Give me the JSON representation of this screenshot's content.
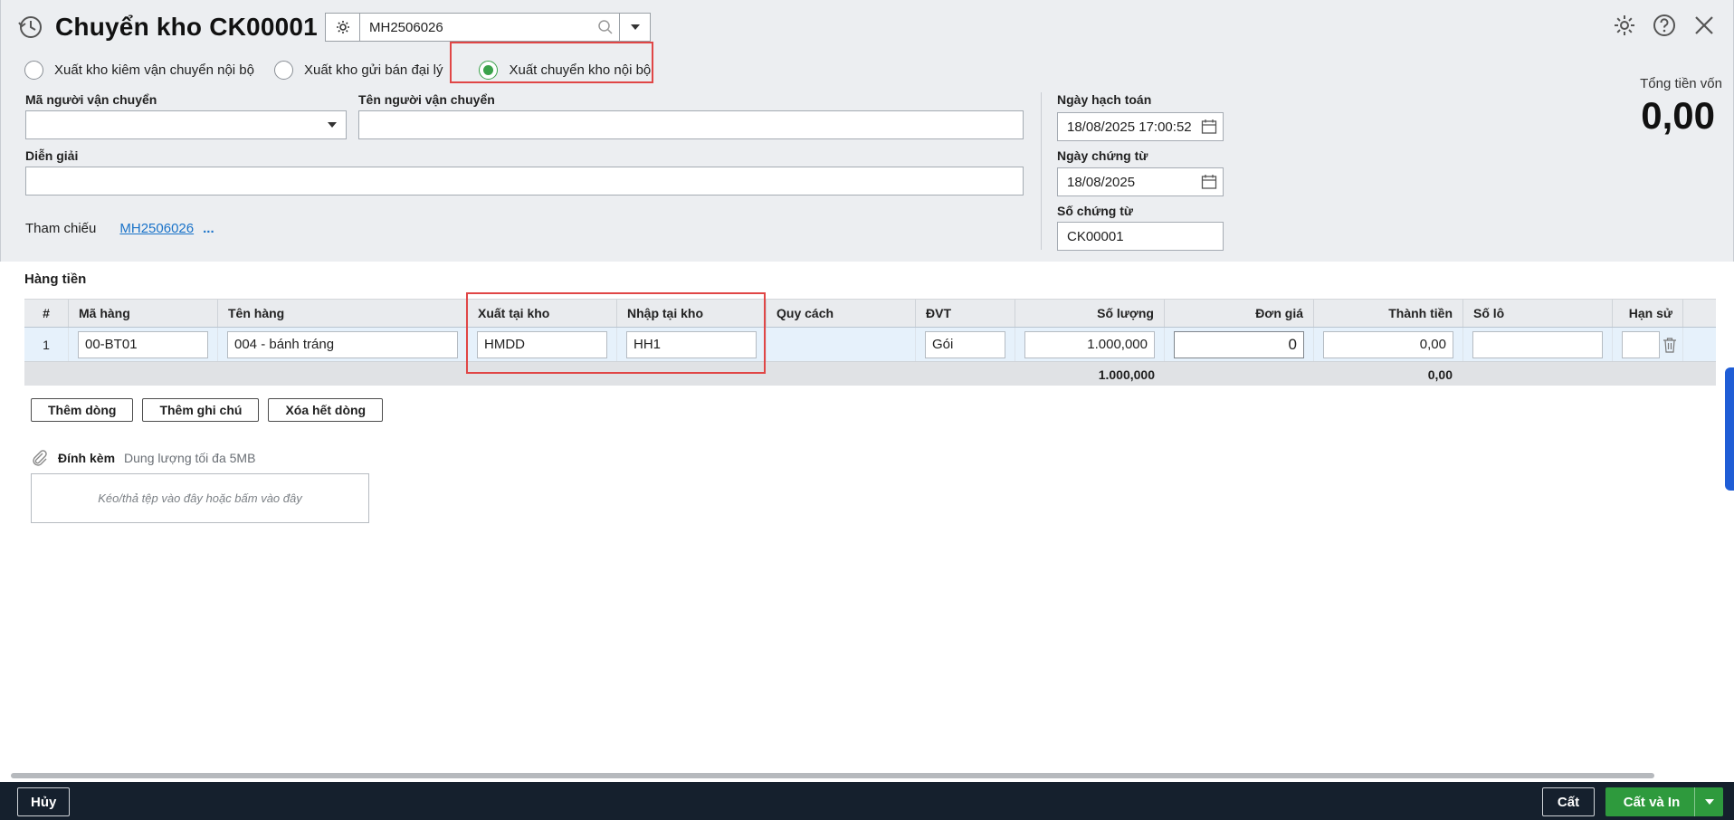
{
  "header": {
    "title": "Chuyển kho CK00001",
    "reference_value": "MH2506026"
  },
  "radios": [
    {
      "label": "Xuất kho kiêm vận chuyển nội bộ",
      "selected": false
    },
    {
      "label": "Xuất kho gửi bán đại lý",
      "selected": false
    },
    {
      "label": "Xuất chuyển kho nội bộ",
      "selected": true
    }
  ],
  "form": {
    "carrier_code_label": "Mã người vận chuyển",
    "carrier_code_value": "",
    "carrier_name_label": "Tên người vận chuyển",
    "carrier_name_value": "",
    "description_label": "Diễn giải",
    "description_value": "",
    "reference_label": "Tham chiếu",
    "reference_link": "MH2506026",
    "reference_more": "...",
    "posting_date_label": "Ngày hạch toán",
    "posting_date_value": "18/08/2025 17:00:52",
    "voucher_date_label": "Ngày chứng từ",
    "voucher_date_value": "18/08/2025",
    "voucher_no_label": "Số chứng từ",
    "voucher_no_value": "CK00001"
  },
  "total": {
    "label": "Tổng tiền vốn",
    "value": "0,00"
  },
  "grid": {
    "section_title": "Hàng tiền",
    "columns": [
      "#",
      "Mã hàng",
      "Tên hàng",
      "Xuất tại kho",
      "Nhập tại kho",
      "Quy cách",
      "ĐVT",
      "Số lượng",
      "Đơn giá",
      "Thành tiền",
      "Số lô",
      "Hạn sử"
    ],
    "rows": [
      {
        "no": "1",
        "code": "00-BT01",
        "name": "004 - bánh tráng",
        "from_wh": "HMDD",
        "to_wh": "HH1",
        "spec": "",
        "unit": "Gói",
        "qty": "1.000,000",
        "price": "0",
        "amount": "0,00",
        "lot": "",
        "expiry": ""
      }
    ],
    "sum_qty": "1.000,000",
    "sum_amount": "0,00"
  },
  "actions": {
    "add_row": "Thêm dòng",
    "add_note": "Thêm ghi chú",
    "delete_all": "Xóa hết dòng"
  },
  "attachment": {
    "title": "Đính kèm",
    "limit": "Dung lượng tối đa 5MB",
    "drop_hint": "Kéo/thả tệp vào đây hoặc bấm vào đây"
  },
  "footer": {
    "cancel": "Hủy",
    "save": "Cất",
    "save_print": "Cất và In"
  },
  "colors": {
    "accent_green": "#2e9a3d",
    "highlight_red": "#e04646",
    "link_blue": "#1a73c9",
    "footer_bg": "#15202d"
  }
}
